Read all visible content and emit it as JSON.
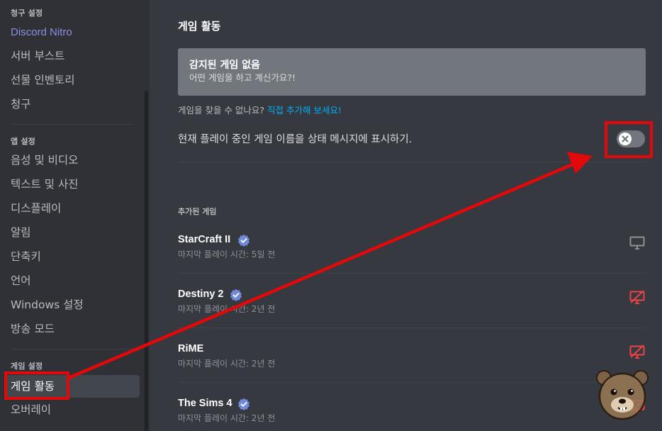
{
  "sidebar": {
    "billing_section": "청구 설정",
    "billing_items": [
      {
        "label": "Discord Nitro"
      },
      {
        "label": "서버 부스트"
      },
      {
        "label": "선물 인벤토리"
      },
      {
        "label": "청구"
      }
    ],
    "app_section": "앱 설정",
    "app_items": [
      {
        "label": "음성 및 비디오"
      },
      {
        "label": "텍스트 및 사진"
      },
      {
        "label": "디스플레이"
      },
      {
        "label": "알림"
      },
      {
        "label": "단축키"
      },
      {
        "label": "언어"
      },
      {
        "label": "Windows 설정"
      },
      {
        "label": "방송 모드"
      }
    ],
    "game_section": "게임 설정",
    "game_items": [
      {
        "label": "게임 활동",
        "selected": true
      },
      {
        "label": "오버레이"
      }
    ]
  },
  "main": {
    "title": "게임 활동",
    "no_game": {
      "title": "감지된 게임 없음",
      "subtitle": "어떤 게임을 하고 계신가요?!"
    },
    "help_text": "게임을 찾을 수 없나요? ",
    "help_link": "직접 추가해 보세요!",
    "status_setting": {
      "label": "현재 플레이 중인 게임 이름을 상태 메시지에 표시하기.",
      "enabled": false
    },
    "added_games_title": "추가된 게임",
    "games": [
      {
        "name": "StarCraft II",
        "verified": true,
        "last_played": "마지막 플레이 시간: 5일 전",
        "overlay_icon": "monitor-icon",
        "overlay_enabled": true
      },
      {
        "name": "Destiny 2",
        "verified": true,
        "last_played": "마지막 플레이 시간: 2년 전",
        "overlay_icon": "monitor-off-icon",
        "overlay_enabled": false
      },
      {
        "name": "RiME",
        "verified": false,
        "last_played": "마지막 플레이 시간: 2년 전",
        "overlay_icon": "monitor-off-icon",
        "overlay_enabled": false
      },
      {
        "name": "The Sims 4",
        "verified": true,
        "last_played": "마지막 플레이 시간: 2년 전",
        "overlay_icon": "monitor-off-icon",
        "overlay_enabled": false
      }
    ]
  },
  "colors": {
    "sidebar_bg": "#2f3136",
    "main_bg": "#36393f",
    "nitro": "#8891e0",
    "link": "#00aff4",
    "verified": "#7289da",
    "overlay_off": "#ed4245",
    "annotation": "#e3080a"
  }
}
